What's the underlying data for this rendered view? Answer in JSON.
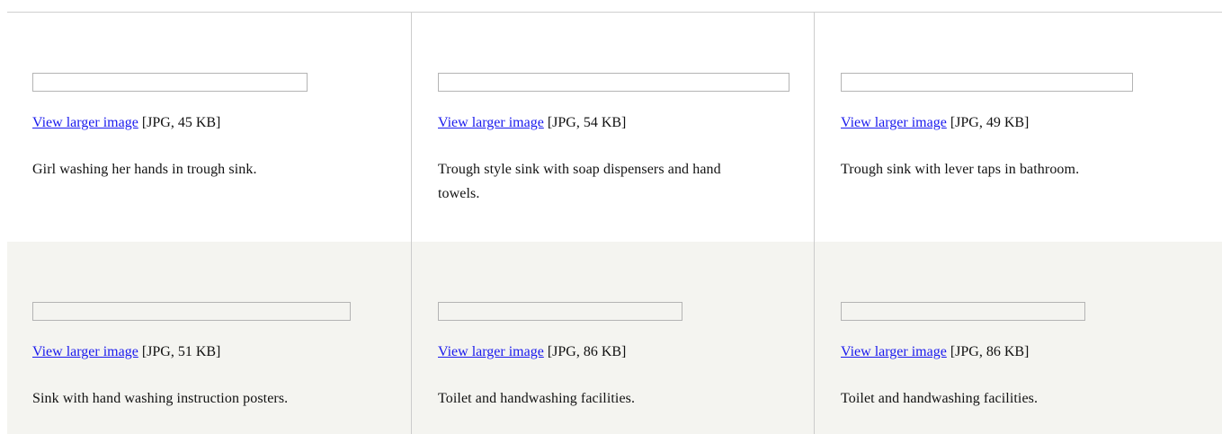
{
  "gallery": {
    "rows": [
      {
        "cells": [
          {
            "link_label": "View larger image",
            "file_info": " [JPG, 45 KB]",
            "caption": "Girl washing her hands in trough sink."
          },
          {
            "link_label": "View larger image",
            "file_info": " [JPG, 54 KB]",
            "caption": "Trough style sink with soap dispensers and hand towels."
          },
          {
            "link_label": "View larger image",
            "file_info": " [JPG, 49 KB]",
            "caption": "Trough sink with lever taps in bathroom."
          }
        ]
      },
      {
        "cells": [
          {
            "link_label": "View larger image",
            "file_info": " [JPG, 51 KB]",
            "caption": "Sink with hand washing instruction posters."
          },
          {
            "link_label": "View larger image",
            "file_info": " [JPG, 86 KB]",
            "caption": "Toilet and handwashing facilities."
          },
          {
            "link_label": "View larger image",
            "file_info": " [JPG, 86 KB]",
            "caption": "Toilet and handwashing facilities."
          }
        ]
      }
    ]
  },
  "colors": {
    "link": "#1a1aee",
    "alt_row_background": "#f4f4f0",
    "divider": "#cccccc"
  }
}
